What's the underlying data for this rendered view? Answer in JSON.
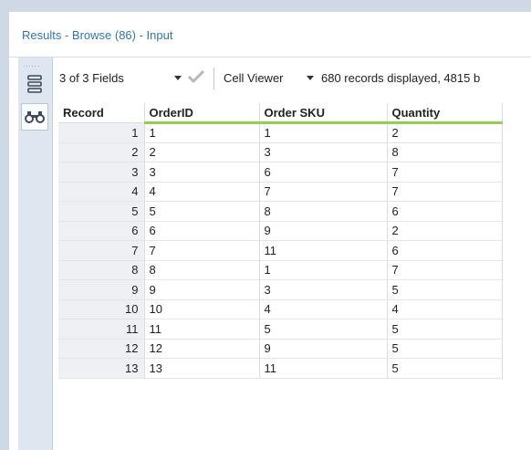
{
  "window": {
    "title": "Results - Browse (86) - Input"
  },
  "side_rail": {
    "icons": [
      "table-view-icon",
      "binoculars-icon"
    ]
  },
  "toolbar": {
    "fields_label": "3 of 3 Fields",
    "apply_icon": "checkmark-icon",
    "viewer_label": "Cell Viewer",
    "status_text": "680 records displayed, 4815 b"
  },
  "grid": {
    "columns": [
      "Record",
      "OrderID",
      "Order SKU",
      "Quantity"
    ],
    "rows": [
      [
        "1",
        "1",
        "1",
        "2"
      ],
      [
        "2",
        "2",
        "3",
        "8"
      ],
      [
        "3",
        "3",
        "6",
        "7"
      ],
      [
        "4",
        "4",
        "7",
        "7"
      ],
      [
        "5",
        "5",
        "8",
        "6"
      ],
      [
        "6",
        "6",
        "9",
        "2"
      ],
      [
        "7",
        "7",
        "11",
        "6"
      ],
      [
        "8",
        "8",
        "1",
        "7"
      ],
      [
        "9",
        "9",
        "3",
        "5"
      ],
      [
        "10",
        "10",
        "4",
        "4"
      ],
      [
        "11",
        "11",
        "5",
        "5"
      ],
      [
        "12",
        "12",
        "9",
        "5"
      ],
      [
        "13",
        "13",
        "11",
        "5"
      ]
    ]
  },
  "colors": {
    "accent_link": "#2e75b6",
    "header_underline": "#92d050",
    "record_column_bg": "#eef0f3"
  }
}
